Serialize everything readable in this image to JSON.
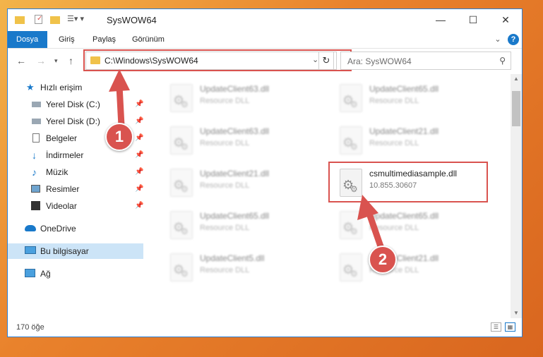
{
  "window": {
    "title": "SysWOW64"
  },
  "ribbon": {
    "tabs": [
      "Dosya",
      "Giriş",
      "Paylaş",
      "Görünüm"
    ]
  },
  "address": {
    "path": "C:\\Windows\\SysWOW64"
  },
  "search": {
    "placeholder": "Ara: SysWOW64"
  },
  "sidebar": {
    "items": [
      {
        "label": "Hızlı erişim"
      },
      {
        "label": "Yerel Disk (C:)"
      },
      {
        "label": "Yerel Disk (D:)"
      },
      {
        "label": "Belgeler"
      },
      {
        "label": "İndirmeler"
      },
      {
        "label": "Müzik"
      },
      {
        "label": "Resimler"
      },
      {
        "label": "Videolar"
      },
      {
        "label": "OneDrive"
      },
      {
        "label": "Bu bilgisayar"
      },
      {
        "label": "Ağ"
      }
    ]
  },
  "files": [
    {
      "name": "UpdateClient63.dll",
      "desc": "Resource DLL"
    },
    {
      "name": "UpdateClient65.dll",
      "desc": "Resource DLL"
    },
    {
      "name": "UpdateClient63.dll",
      "desc": "Resource DLL"
    },
    {
      "name": "UpdateClient21.dll",
      "desc": "Resource DLL"
    },
    {
      "name": "UpdateClient21.dll",
      "desc": "Resource DLL"
    },
    {
      "name": "csmultimediasample.dll",
      "desc": "10.855.30607"
    },
    {
      "name": "UpdateClient65.dll",
      "desc": "Resource DLL"
    },
    {
      "name": "UpdateClient65.dll",
      "desc": "Resource DLL"
    },
    {
      "name": "UpdateClient5.dll",
      "desc": "Resource DLL"
    },
    {
      "name": "UpdateClient21.dll",
      "desc": "Resource DLL"
    }
  ],
  "status": {
    "count": "170 öğe"
  },
  "annotations": {
    "step1": "1",
    "step2": "2"
  },
  "colors": {
    "accent": "#1979ca",
    "highlight": "#d9534f",
    "selection": "#cce4f7"
  }
}
